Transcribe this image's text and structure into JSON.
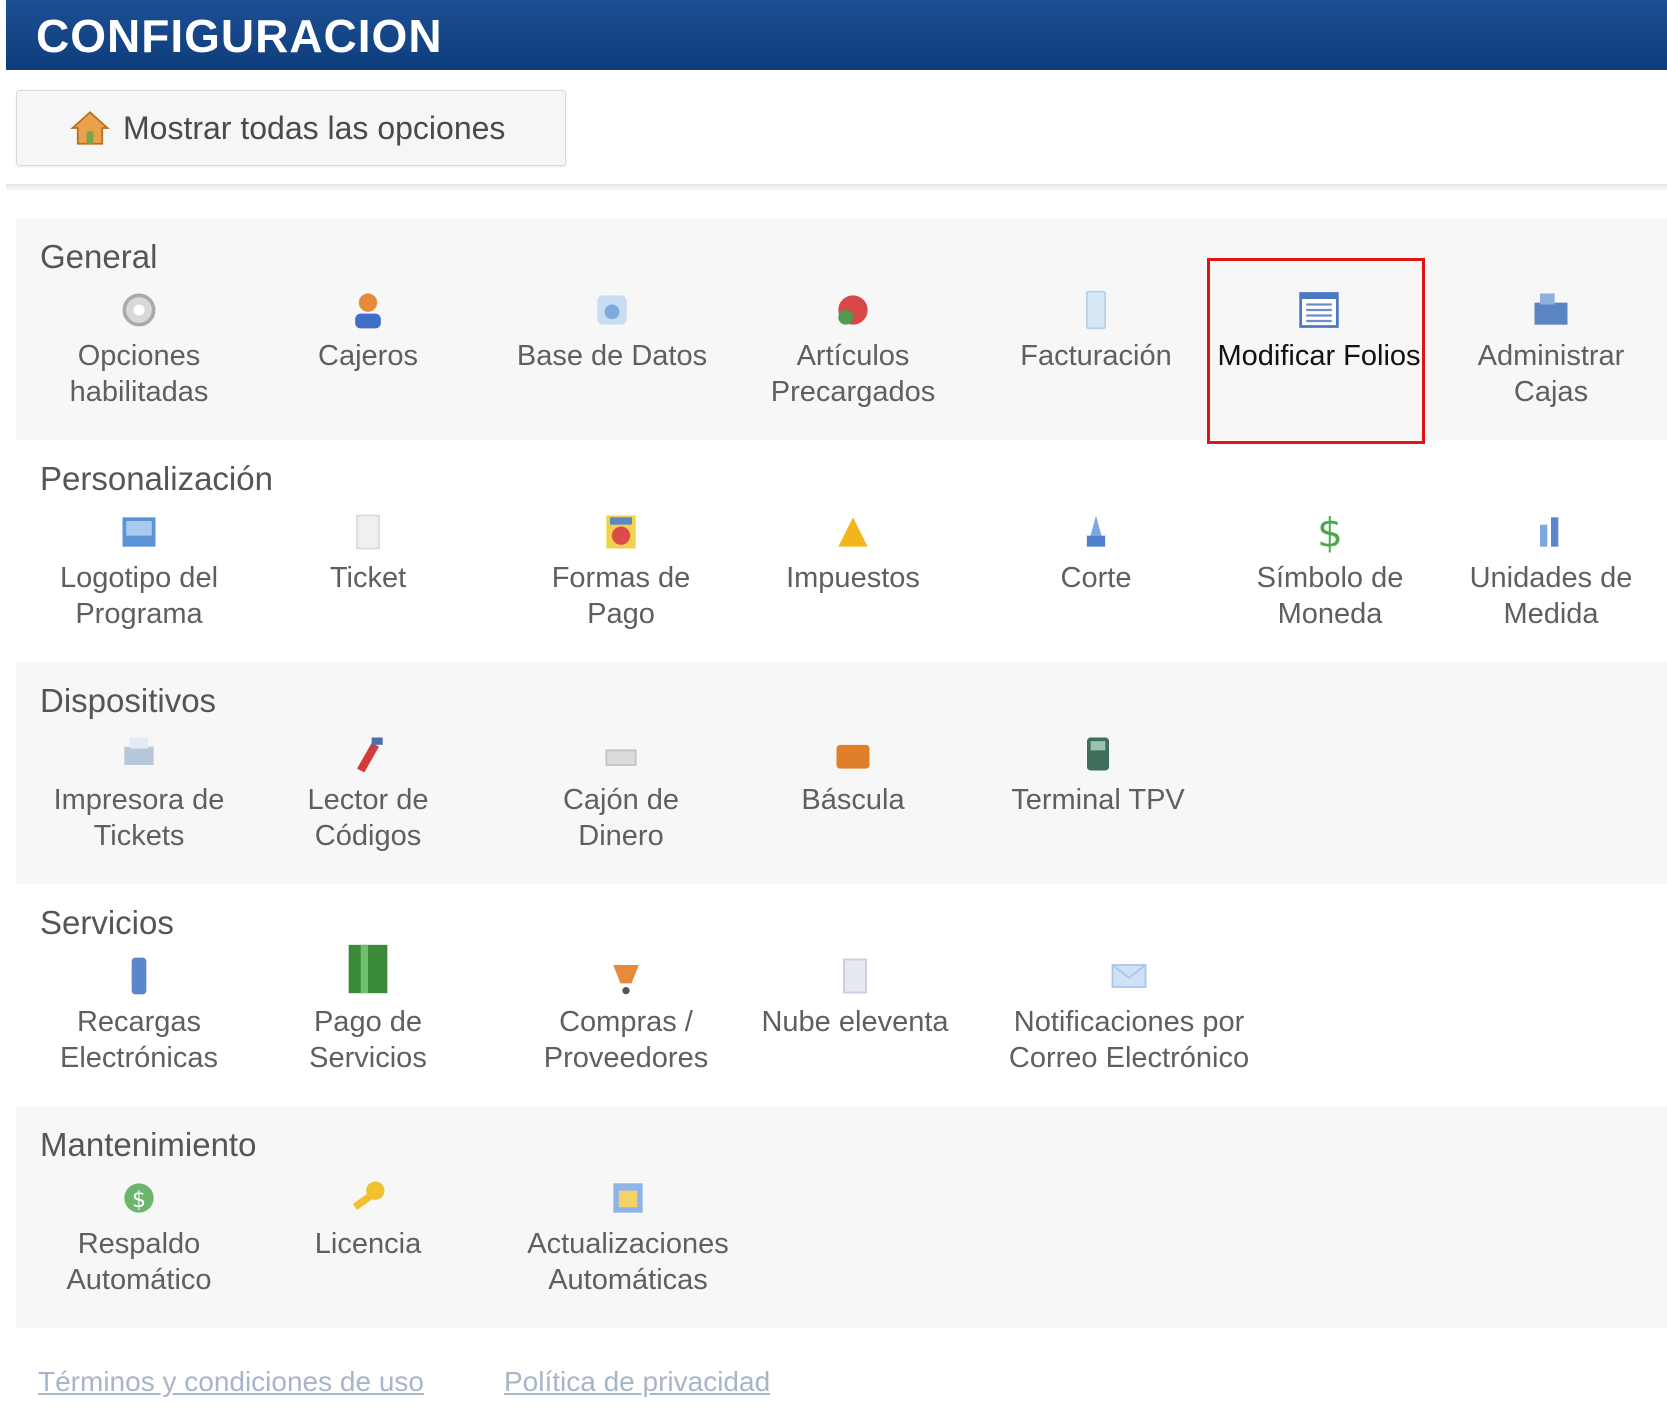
{
  "header": {
    "title": "CONFIGURACION"
  },
  "toolbar": {
    "show_all_label": "Mostrar todas las opciones"
  },
  "sections": [
    {
      "title": "General",
      "items": [
        {
          "label": "Opciones habilitadas",
          "icon": "gear-icon"
        },
        {
          "label": "Cajeros",
          "icon": "user-icon"
        },
        {
          "label": "Base de Datos",
          "icon": "database-icon"
        },
        {
          "label": "Artículos Precargados",
          "icon": "box-icon"
        },
        {
          "label": "Facturación",
          "icon": "invoice-icon"
        },
        {
          "label": "Modificar Folios",
          "icon": "list-icon"
        },
        {
          "label": "Administrar Cajas",
          "icon": "cash-register-icon"
        }
      ]
    },
    {
      "title": "Personalización",
      "items": [
        {
          "label": "Logotipo del Programa",
          "icon": "image-icon"
        },
        {
          "label": "Ticket",
          "icon": "ticket-icon"
        },
        {
          "label": "Formas de Pago",
          "icon": "payment-icon"
        },
        {
          "label": "Impuestos",
          "icon": "tax-icon"
        },
        {
          "label": "Corte",
          "icon": "cut-icon"
        },
        {
          "label": "Símbolo de Moneda",
          "icon": "dollar-icon"
        },
        {
          "label": "Unidades de Medida",
          "icon": "ruler-icon"
        }
      ]
    },
    {
      "title": "Dispositivos",
      "items": [
        {
          "label": "Impresora de Tickets",
          "icon": "printer-icon"
        },
        {
          "label": "Lector de Códigos",
          "icon": "barcode-scanner-icon"
        },
        {
          "label": "Cajón de Dinero",
          "icon": "cash-drawer-icon"
        },
        {
          "label": "Báscula",
          "icon": "scale-icon"
        },
        {
          "label": "Terminal TPV",
          "icon": "pos-terminal-icon"
        }
      ]
    },
    {
      "title": "Servicios",
      "items": [
        {
          "label": "Recargas Electrónicas",
          "icon": "phone-icon"
        },
        {
          "label": "Pago de Servicios",
          "icon": "bill-icon"
        },
        {
          "label": "Compras / Proveedores",
          "icon": "cart-icon"
        },
        {
          "label": "Nube eleventa",
          "icon": "cloud-icon"
        },
        {
          "label": "Notificaciones por Correo Electrónico",
          "icon": "mail-icon"
        }
      ]
    },
    {
      "title": "Mantenimiento",
      "items": [
        {
          "label": "Respaldo Automático",
          "icon": "backup-icon"
        },
        {
          "label": "Licencia",
          "icon": "key-icon"
        },
        {
          "label": "Actualizaciones Automáticas",
          "icon": "update-icon"
        }
      ]
    }
  ],
  "footer": {
    "terms_label": "Términos y condiciones de uso",
    "privacy_label": "Política de privacidad"
  },
  "colors": {
    "header_bg": "#0e3d7c",
    "highlight_border": "#e01414",
    "section_alt_bg": "#f7f7f7"
  }
}
